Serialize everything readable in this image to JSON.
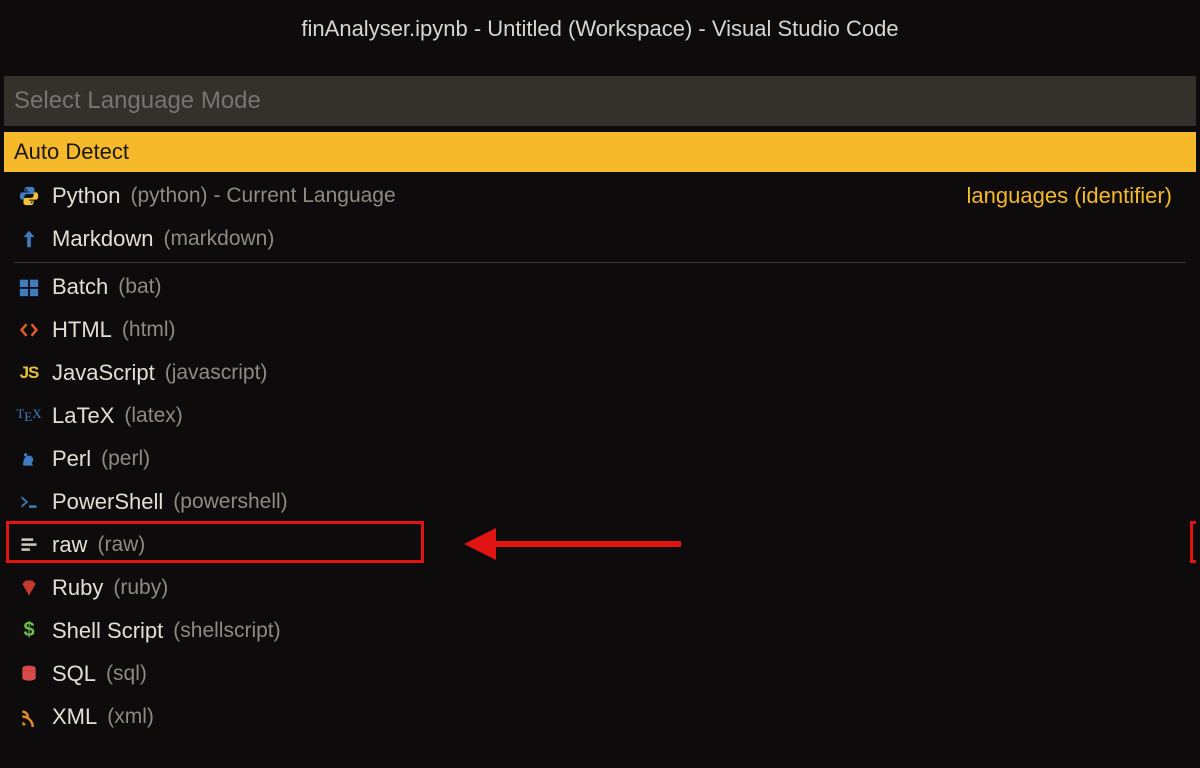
{
  "title": "finAnalyser.ipynb - Untitled (Workspace) - Visual Studio Code",
  "picker": {
    "placeholder": "Select Language Mode",
    "auto_detect": "Auto Detect",
    "right_hint": "languages (identifier)"
  },
  "top": [
    {
      "name": "Python",
      "id": "(python)",
      "suffix": "- Current Language",
      "icon": "python"
    },
    {
      "name": "Markdown",
      "id": "(markdown)",
      "suffix": "",
      "icon": "markdown"
    }
  ],
  "langs": [
    {
      "name": "Batch",
      "id": "(bat)",
      "icon": "batch"
    },
    {
      "name": "HTML",
      "id": "(html)",
      "icon": "html"
    },
    {
      "name": "JavaScript",
      "id": "(javascript)",
      "icon": "js"
    },
    {
      "name": "LaTeX",
      "id": "(latex)",
      "icon": "latex"
    },
    {
      "name": "Perl",
      "id": "(perl)",
      "icon": "perl"
    },
    {
      "name": "PowerShell",
      "id": "(powershell)",
      "icon": "powershell"
    },
    {
      "name": "raw",
      "id": "(raw)",
      "icon": "raw"
    },
    {
      "name": "Ruby",
      "id": "(ruby)",
      "icon": "ruby"
    },
    {
      "name": "Shell Script",
      "id": "(shellscript)",
      "icon": "shell"
    },
    {
      "name": "SQL",
      "id": "(sql)",
      "icon": "sql"
    },
    {
      "name": "XML",
      "id": "(xml)",
      "icon": "xml"
    }
  ],
  "colors": {
    "accent": "#f5b92a",
    "highlight": "#e11313"
  }
}
